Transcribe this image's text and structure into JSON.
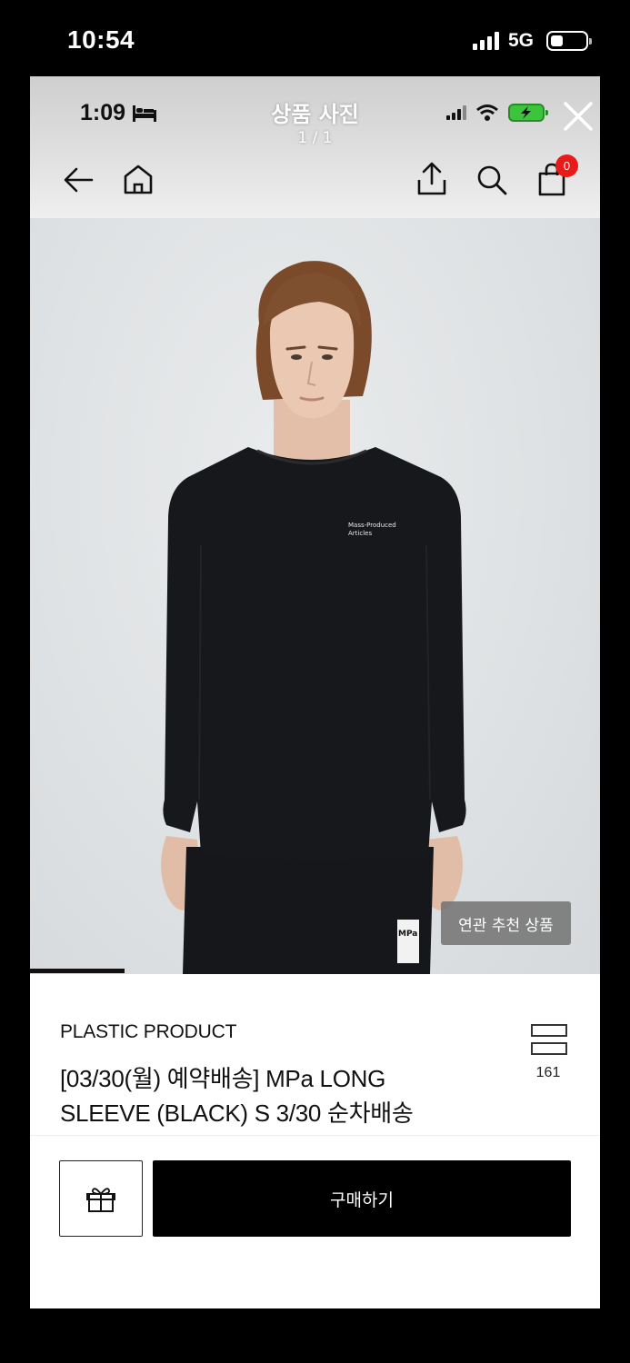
{
  "outer_status": {
    "time": "10:54",
    "network": "5G"
  },
  "viewer": {
    "title": "상품 사진",
    "counter": "1 / 1"
  },
  "inner_status": {
    "time": "1:09"
  },
  "cart": {
    "badge_count": "0"
  },
  "photo": {
    "related_label": "연관 추천 상품",
    "shirt_print_line1": "Mass-Produced",
    "shirt_print_line2": "Articles",
    "shorts_logo": "MPa"
  },
  "product": {
    "brand": "PLASTIC PRODUCT",
    "name_line1": "[03/30(월) 예약배송]  MPa LONG",
    "name_line2": "SLEEVE (BLACK) S 3/30 순차배송",
    "review_count": "161"
  },
  "actions": {
    "buy_label": "구매하기"
  },
  "icons": {
    "back": "arrow-left-icon",
    "home": "home-icon",
    "share": "share-icon",
    "search": "search-icon",
    "cart": "shopping-bag-icon",
    "gift": "gift-icon",
    "close": "close-icon",
    "review": "stack-icon"
  },
  "colors": {
    "badge": "#e81b1b",
    "buy_button": "#000000",
    "battery": "#3cc43c"
  }
}
